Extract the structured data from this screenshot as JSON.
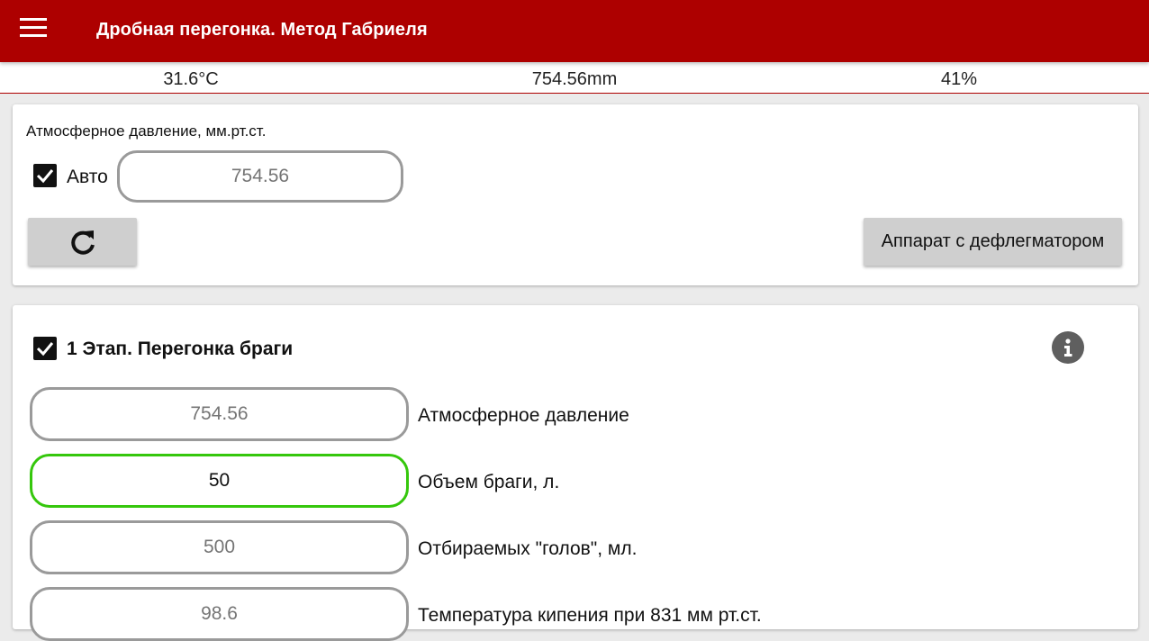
{
  "app": {
    "title": "Дробная перегонка. Метод Габриеля",
    "menu_icon": "hamburger-menu-icon"
  },
  "status": {
    "temperature": "31.6°C",
    "pressure": "754.56mm",
    "humidity": "41%"
  },
  "pressure_card": {
    "title": "Атмосферное давление, мм.рт.ст.",
    "auto_label": "Авто",
    "auto_checked": true,
    "pressure_placeholder": "754.56",
    "refresh_icon": "refresh-icon",
    "apparatus_button": "Аппарат с дефлегматором"
  },
  "stage1": {
    "checked": true,
    "title": "1 Этап. Перегонка браги",
    "info_icon": "info-icon",
    "fields": [
      {
        "placeholder": "754.56",
        "value": "",
        "label": "Атмосферное давление"
      },
      {
        "placeholder": "",
        "value": "50",
        "label": "Объем браги, л."
      },
      {
        "placeholder": "500",
        "value": "",
        "label": "Отбираемых \"голов\", мл."
      },
      {
        "placeholder": "98.6",
        "value": "",
        "label": "Температура кипения при 831 мм рт.ст."
      }
    ]
  },
  "colors": {
    "appbar": "#ad0000",
    "active_border": "#35c70c",
    "inactive_border": "#9a9a9a",
    "button_bg": "#cfcfcf"
  }
}
